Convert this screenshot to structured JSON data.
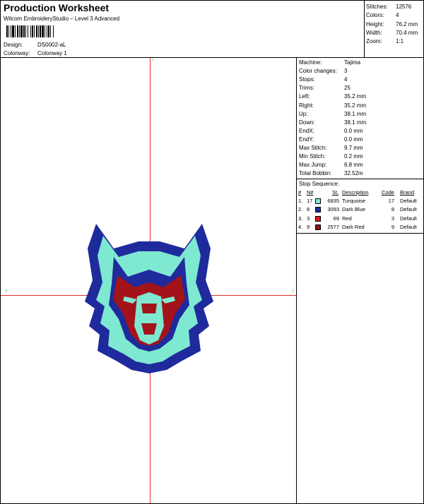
{
  "header": {
    "title": "Production Worksheet",
    "subtitle": "Wilcom EmbroideryStudio – Level 3 Advanced",
    "design_label": "Design:",
    "design_value": "DS0002-aL",
    "colorway_label": "Colonway:",
    "colorway_value": "Colonway 1"
  },
  "stats": {
    "stitches_label": "Stitches:",
    "stitches": "12576",
    "colors_label": "Colors:",
    "colors": "4",
    "height_label": "Height:",
    "height": "76.2 mm",
    "width_label": "Width:",
    "width": "70.4 mm",
    "zoom_label": "Zoom:",
    "zoom": "1:1"
  },
  "machine": [
    {
      "label": "Machine:",
      "value": "Tajima"
    },
    {
      "label": "Color changes:",
      "value": "3"
    },
    {
      "label": "Stops:",
      "value": "4"
    },
    {
      "label": "Trims:",
      "value": "25"
    },
    {
      "label": "Left:",
      "value": "35.2 mm"
    },
    {
      "label": "Right:",
      "value": "35.2 mm"
    },
    {
      "label": "Up:",
      "value": "38.1 mm"
    },
    {
      "label": "Down:",
      "value": "38.1 mm"
    },
    {
      "label": "EndX:",
      "value": "0.0 mm"
    },
    {
      "label": "EndY:",
      "value": "0.0 mm"
    },
    {
      "label": "Max Stitch:",
      "value": "9.7 mm"
    },
    {
      "label": "Min Stitch:",
      "value": "0.2 mm"
    },
    {
      "label": "Max Jump:",
      "value": "6.8 mm"
    },
    {
      "label": "Total Bobbin:",
      "value": "32.52m"
    }
  ],
  "stop_sequence": {
    "title": "Stop Sequence:",
    "headers": {
      "num": "#",
      "n": "N#",
      "st": "St.",
      "description": "Description",
      "code": "Code",
      "brand": "Brand"
    },
    "rows": [
      {
        "num": "1.",
        "n": "17",
        "color": "#7ee8d0",
        "st": "6835",
        "description": "Turquoise",
        "code": "17",
        "brand": "Default"
      },
      {
        "num": "2.",
        "n": "8",
        "color": "#1f2a9c",
        "st": "3093",
        "description": "Dark Blue",
        "code": "8",
        "brand": "Default"
      },
      {
        "num": "3.",
        "n": "3",
        "color": "#e01818",
        "st": "69",
        "description": "Red",
        "code": "3",
        "brand": "Default"
      },
      {
        "num": "4.",
        "n": "9",
        "color": "#8e1212",
        "st": "2577",
        "description": "Dark Red",
        "code": "9",
        "brand": "Default"
      }
    ]
  },
  "guides": {
    "top": "1",
    "left": "3",
    "right": "2"
  },
  "colors": {
    "guide": "#e03030",
    "turquoise": "#7ee8d0",
    "dark_blue": "#1f2a9c",
    "dark_red": "#a3141a"
  }
}
